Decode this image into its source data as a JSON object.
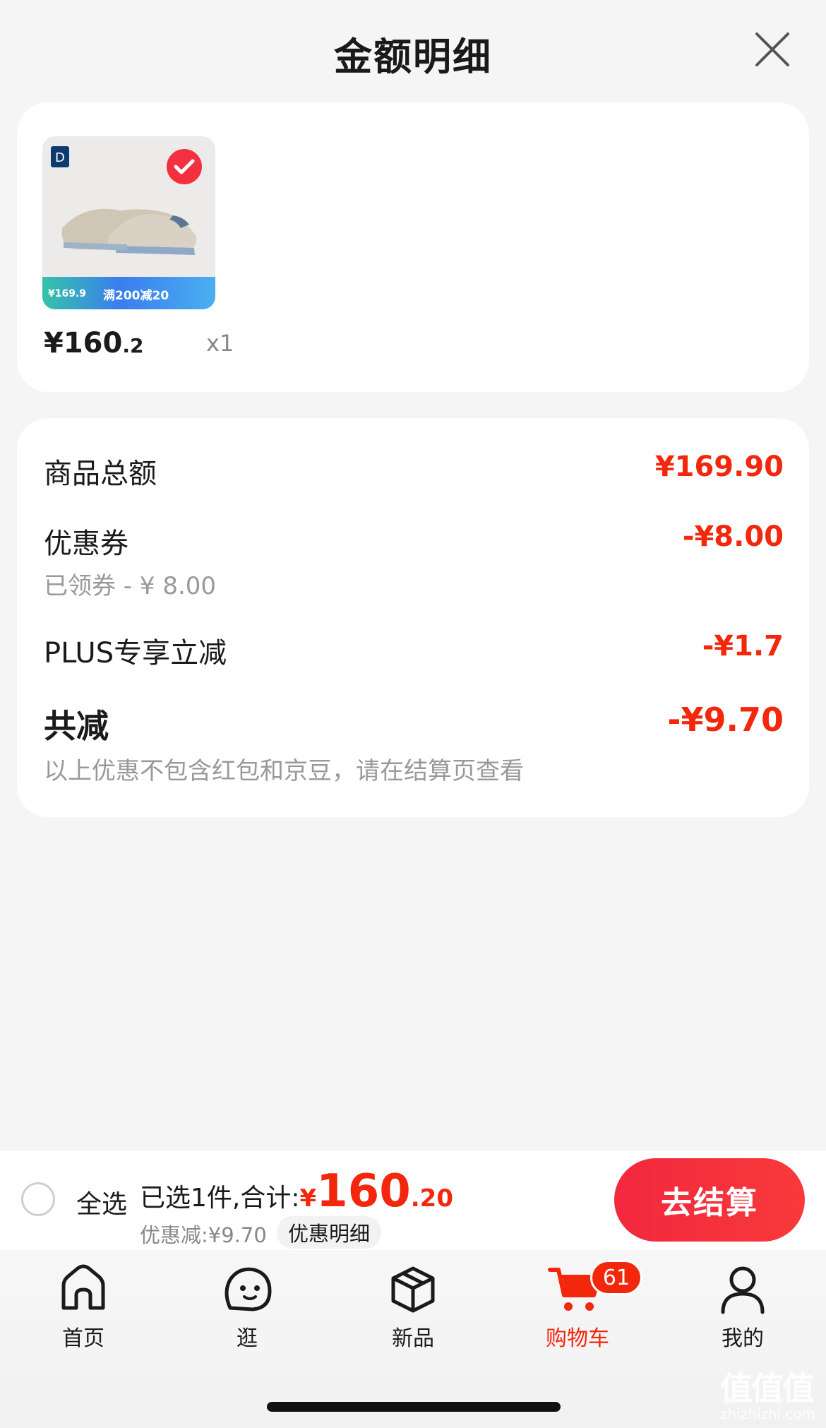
{
  "sheet": {
    "title": "金额明细"
  },
  "product": {
    "brand_logo_text": "D",
    "promo_text": "满200减20",
    "promo_price": "¥169.9",
    "price_main": "¥160",
    "price_decimal": ".2",
    "qty": "x1"
  },
  "breakdown": {
    "items_total_label": "商品总额",
    "items_total_value": "¥169.90",
    "coupon_label": "优惠券",
    "coupon_value": "-¥8.00",
    "coupon_sub": "已领券 - ¥ 8.00",
    "plus_label": "PLUS专享立减",
    "plus_value": "-¥1.7",
    "total_discount_label": "共减",
    "total_discount_value": "-¥9.70",
    "note": "以上优惠不包含红包和京豆，请在结算页查看"
  },
  "bottom_bar": {
    "select_all": "全选",
    "summary_prefix": "已选1件,合计:",
    "total_currency": "¥",
    "total_int": "160",
    "total_dec": ".20",
    "discount_text": "优惠减:¥9.70",
    "detail_chip": "优惠明细",
    "checkout": "去结算"
  },
  "tabbar": {
    "home": "首页",
    "browse": "逛",
    "new": "新品",
    "cart": "购物车",
    "cart_badge": "61",
    "mine": "我的"
  },
  "watermark": {
    "main": "值值值",
    "sub": "zhizhizhi.com"
  },
  "colors": {
    "accent": "#f2270c",
    "checkout": "#f2283f",
    "background": "#f5f5f5"
  }
}
